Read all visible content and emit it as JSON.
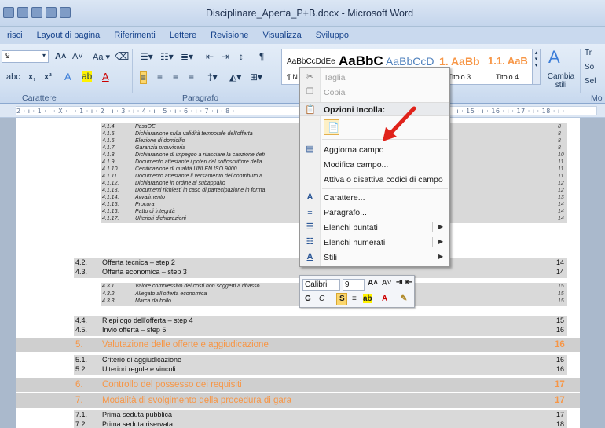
{
  "window": {
    "title": "Disciplinare_Aperta_P+B.docx - Microsoft Word"
  },
  "tabs": [
    "risci",
    "Layout di pagina",
    "Riferimenti",
    "Lettere",
    "Revisione",
    "Visualizza",
    "Sviluppo"
  ],
  "ribbon": {
    "font_size": "9",
    "groups": {
      "font": "Carattere",
      "paragraph": "Paragrafo",
      "styles_short": "Mo"
    },
    "styles": [
      {
        "preview": "AaBbCcDdEe",
        "name": "¶ N"
      },
      {
        "preview": "AaBbC",
        "name": ""
      },
      {
        "preview": "AaBbCcD",
        "name": ""
      },
      {
        "preview": "1. AaBb",
        "name": "Titolo 3"
      },
      {
        "preview": "1.1. AaB",
        "name": "Titolo 4"
      }
    ],
    "change_styles": "Cambia stili",
    "editing": [
      "Tr",
      "So",
      "Sel"
    ]
  },
  "ruler": {
    "text": "2 · ı · 1 · ı · X · ı · 1 · ı · 2 · ı · 3 · ı · 4 · ı · 5 · ı · 6 · ı · 7 · ı · 8 ·",
    "text_right": "14 · ı · 15 · ı · 16 · ı · 17 · ı · 18 · ı ·"
  },
  "toc": {
    "sub_a": [
      {
        "num": "4.1.4.",
        "text": "PassOE",
        "page": "8"
      },
      {
        "num": "4.1.5.",
        "text": "Dichiarazione sulla validità temporale dell'offerta",
        "page": "8"
      },
      {
        "num": "4.1.6.",
        "text": "Elezione di domicilio",
        "page": "8"
      },
      {
        "num": "4.1.7.",
        "text": "Garanzia provvisoria",
        "page": "8"
      },
      {
        "num": "4.1.8.",
        "text": "Dichiarazione di impegno a rilasciare la cauzione defi",
        "page": "10"
      },
      {
        "num": "4.1.9.",
        "text": "Documento attestante i poteri del sottoscrittore della",
        "page": "11"
      },
      {
        "num": "4.1.10.",
        "text": "Certificazione di qualità UNI EN ISO 9000",
        "page": "11"
      },
      {
        "num": "4.1.11.",
        "text": "Documento attestante il versamento del contributo a",
        "page": "11"
      },
      {
        "num": "4.1.12.",
        "text": "Dichiarazione in ordine al subappalto",
        "page": "12"
      },
      {
        "num": "4.1.13.",
        "text": "Documenti richiesti in caso di partecipazione in forma",
        "page": "12"
      },
      {
        "num": "4.1.14.",
        "text": "Avvalimento",
        "page": "13"
      },
      {
        "num": "4.1.15.",
        "text": "Procura",
        "page": "14"
      },
      {
        "num": "4.1.16.",
        "text": "Patto di integrità",
        "page": "14"
      },
      {
        "num": "4.1.17.",
        "text": "Ulteriori dichiarazioni",
        "page": "14"
      }
    ],
    "mid": [
      {
        "num": "4.2.",
        "text": "Offerta tecnica – step 2",
        "page": "14"
      },
      {
        "num": "4.3.",
        "text": "Offerta economica – step 3",
        "page": "14"
      }
    ],
    "sub_b": [
      {
        "num": "4.3.1.",
        "text": "Valore complessivo dei costi non soggetti a ribasso",
        "page": "15"
      },
      {
        "num": "4.3.2.",
        "text": "Allegato all'offerta economica",
        "page": "15"
      },
      {
        "num": "4.3.3.",
        "text": "Marca da bollo",
        "page": "15"
      }
    ],
    "mid2": [
      {
        "num": "4.4.",
        "text": "Riepilogo dell'offerta – step 4",
        "page": "15"
      },
      {
        "num": "4.5.",
        "text": "Invio offerta – step 5",
        "page": "16"
      }
    ],
    "h5": {
      "num": "5.",
      "text": "Valutazione delle offerte e aggiudicazione",
      "page": "16"
    },
    "mid3": [
      {
        "num": "5.1.",
        "text": "Criterio di aggiudicazione",
        "page": "16"
      },
      {
        "num": "5.2.",
        "text": "Ulteriori regole e vincoli",
        "page": "16"
      }
    ],
    "h6": {
      "num": "6.",
      "text": "Controllo del possesso dei requisiti",
      "page": "17"
    },
    "h7": {
      "num": "7.",
      "text": "Modalità di svolgimento della procedura di gara",
      "page": "17"
    },
    "mid4": [
      {
        "num": "7.1.",
        "text": "Prima seduta pubblica",
        "page": "17"
      },
      {
        "num": "7.2.",
        "text": "Prima seduta riservata",
        "page": "18"
      }
    ]
  },
  "context_menu": {
    "cut": "Taglia",
    "copy": "Copia",
    "paste_header": "Opzioni Incolla:",
    "items": [
      {
        "label": "Aggiorna campo",
        "icon": "update-field-icon"
      },
      {
        "label": "Modifica campo...",
        "icon": ""
      },
      {
        "label": "Attiva o disattiva codici di campo",
        "icon": ""
      },
      {
        "label": "Carattere...",
        "icon": "font-icon"
      },
      {
        "label": "Paragrafo...",
        "icon": "paragraph-icon"
      },
      {
        "label": "Elenchi puntati",
        "icon": "bullets-icon"
      },
      {
        "label": "Elenchi numerati",
        "icon": "numbering-icon"
      },
      {
        "label": "Stili",
        "icon": "styles-icon"
      }
    ]
  },
  "mini_toolbar": {
    "font": "Calibri",
    "size": "9"
  },
  "colors": {
    "heading_orange": "#f79646",
    "arrow_red": "#e0231b"
  }
}
